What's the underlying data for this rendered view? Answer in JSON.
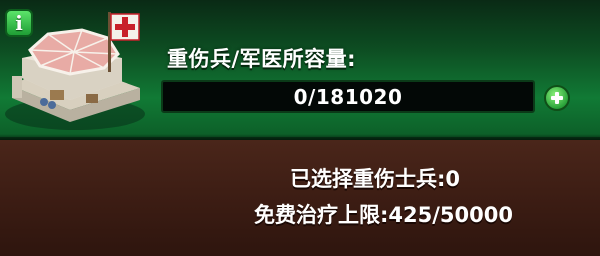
{
  "header": {
    "info_icon": "i"
  },
  "capacity": {
    "label": "重伤兵/军医所容量:",
    "value": "0/181020",
    "fill_fraction": 0
  },
  "stats": {
    "selected_label": "已选择重伤士兵:",
    "selected_value": "0",
    "limit_label": "免费治疗上限:",
    "limit_value": "425/50000"
  },
  "colors": {
    "top_panel": "#117a35",
    "bottom_panel": "#3b1c13",
    "bar_bg": "#030806",
    "accent_green": "#2aa33a",
    "flag_red": "#c8202a"
  }
}
